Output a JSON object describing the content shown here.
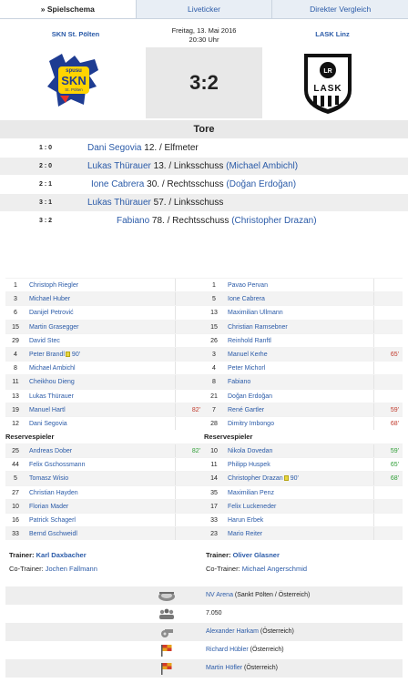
{
  "tabs": [
    {
      "label": "» Spielschema"
    },
    {
      "label": "Liveticker"
    },
    {
      "label": "Direkter Vergleich"
    }
  ],
  "match": {
    "home_team": "SKN St. Pölten",
    "away_team": "LASK Linz",
    "date": "Freitag, 13. Mai 2016",
    "time": "20:30 Uhr",
    "score": "3:2",
    "home_logo_text": "spusu SKN St. Pölten",
    "away_logo_text": "LASK"
  },
  "goals_title": "Tore",
  "goals": [
    {
      "score": "1 : 0",
      "scorer": "Dani Segovia",
      "detail": " 12. / Elfmeter",
      "assist": ""
    },
    {
      "score": "2 : 0",
      "scorer": "Lukas Thürauer",
      "detail": " 13. / Linksschuss ",
      "assist": "(Michael Ambichl)"
    },
    {
      "score": "2 : 1",
      "scorer": "Ione Cabrera",
      "detail": " 30. / Rechtsschuss ",
      "assist": "(Doğan Erdoğan)"
    },
    {
      "score": "3 : 1",
      "scorer": "Lukas Thürauer",
      "detail": " 57. / Linksschuss",
      "assist": ""
    },
    {
      "score": "3 : 2",
      "scorer": "Fabiano",
      "detail": " 78. / Rechtsschuss ",
      "assist": "(Christopher Drazan)"
    }
  ],
  "home_lineup": {
    "starters": [
      {
        "num": "1",
        "name": "Christoph Riegler",
        "minute": ""
      },
      {
        "num": "3",
        "name": "Michael Huber",
        "minute": ""
      },
      {
        "num": "6",
        "name": "Danijel Petrović",
        "minute": ""
      },
      {
        "num": "15",
        "name": "Martin Grasegger",
        "minute": ""
      },
      {
        "num": "29",
        "name": "David Stec",
        "minute": ""
      },
      {
        "num": "4",
        "name": "Peter Brandl",
        "card": "90'",
        "minute": ""
      },
      {
        "num": "8",
        "name": "Michael Ambichl",
        "minute": ""
      },
      {
        "num": "11",
        "name": "Cheikhou Dieng",
        "minute": ""
      },
      {
        "num": "13",
        "name": "Lukas Thürauer",
        "minute": ""
      },
      {
        "num": "19",
        "name": "Manuel Hartl",
        "minute": "82'"
      },
      {
        "num": "12",
        "name": "Dani Segovia",
        "minute": ""
      }
    ],
    "reserve_label": "Reservespieler",
    "reserves": [
      {
        "num": "25",
        "name": "Andreas Dober",
        "minute": "82'"
      },
      {
        "num": "44",
        "name": "Felix Gschossmann",
        "minute": ""
      },
      {
        "num": "5",
        "name": "Tomasz Wisio",
        "minute": ""
      },
      {
        "num": "27",
        "name": "Christian Hayden",
        "minute": ""
      },
      {
        "num": "10",
        "name": "Florian Mader",
        "minute": ""
      },
      {
        "num": "16",
        "name": "Patrick Schagerl",
        "minute": ""
      },
      {
        "num": "33",
        "name": "Bernd Gschweidl",
        "minute": ""
      }
    ]
  },
  "away_lineup": {
    "starters": [
      {
        "num": "1",
        "name": "Pavao Pervan",
        "minute": ""
      },
      {
        "num": "5",
        "name": "Ione Cabrera",
        "minute": ""
      },
      {
        "num": "13",
        "name": "Maximilian Ullmann",
        "minute": ""
      },
      {
        "num": "15",
        "name": "Christian Ramsebner",
        "minute": ""
      },
      {
        "num": "26",
        "name": "Reinhold Ranftl",
        "minute": ""
      },
      {
        "num": "3",
        "name": "Manuel Kerhe",
        "minute": "65'"
      },
      {
        "num": "4",
        "name": "Peter Michorl",
        "minute": ""
      },
      {
        "num": "8",
        "name": "Fabiano",
        "minute": ""
      },
      {
        "num": "21",
        "name": "Doğan Erdoğan",
        "minute": ""
      },
      {
        "num": "7",
        "name": "René Gartler",
        "minute": "59'"
      },
      {
        "num": "28",
        "name": "Dimitry Imbongo",
        "minute": "68'"
      }
    ],
    "reserve_label": "Reservespieler",
    "reserves": [
      {
        "num": "10",
        "name": "Nikola Dovedan",
        "minute": "59'"
      },
      {
        "num": "11",
        "name": "Philipp Huspek",
        "minute": "65'"
      },
      {
        "num": "14",
        "name": "Christopher Drazan",
        "card": "90'",
        "minute": "68'"
      },
      {
        "num": "35",
        "name": "Maximilian Penz",
        "minute": ""
      },
      {
        "num": "17",
        "name": "Felix Luckeneder",
        "minute": ""
      },
      {
        "num": "33",
        "name": "Harun Erbek",
        "minute": ""
      },
      {
        "num": "23",
        "name": "Mario Reiter",
        "minute": ""
      }
    ]
  },
  "trainers": {
    "home": {
      "trainer_label": "Trainer:",
      "trainer": "Karl Daxbacher",
      "co_label": "Co-Trainer:",
      "co": "Jochen Fallmann"
    },
    "away": {
      "trainer_label": "Trainer:",
      "trainer": "Oliver Glasner",
      "co_label": "Co-Trainer:",
      "co": "Michael Angerschmid"
    }
  },
  "info": [
    {
      "icon": "stadium-icon",
      "value": "NV Arena",
      "suffix": " (Sankt Pölten / Österreich)"
    },
    {
      "icon": "crowd-icon",
      "value": "",
      "suffix": "7.050"
    },
    {
      "icon": "whistle-icon",
      "value": "Alexander Harkam",
      "suffix": " (Österreich)"
    },
    {
      "icon": "flag-icon",
      "value": "Richard Hübler",
      "suffix": " (Österreich)"
    },
    {
      "icon": "flag-icon",
      "value": "Martin Höfler",
      "suffix": " (Österreich)"
    }
  ],
  "colors": {
    "link": "#2b5ba8",
    "sub_out": "#c0392b",
    "sub_in": "#2e9e35",
    "card": "#e8d640"
  }
}
